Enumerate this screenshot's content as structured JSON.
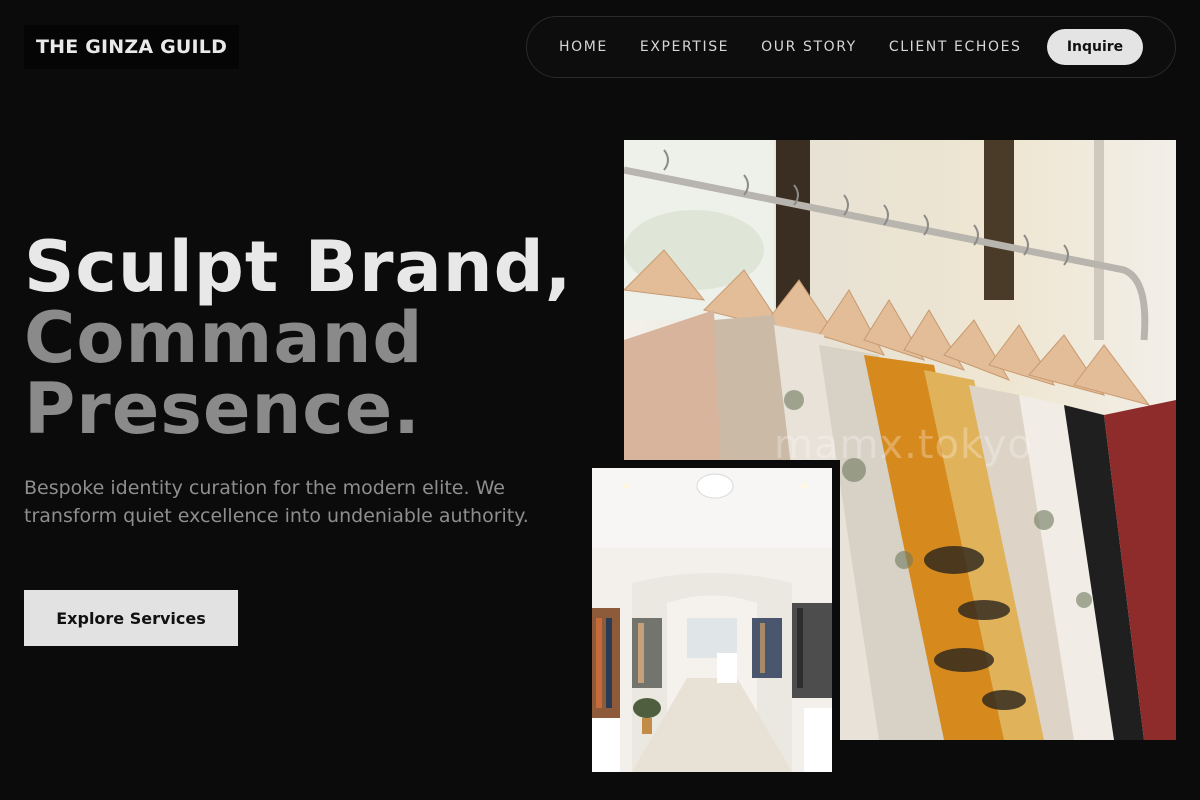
{
  "brand": {
    "logo_text": "THE GINZA GUILD"
  },
  "nav": {
    "links": [
      "HOME",
      "EXPERTISE",
      "OUR STORY",
      "CLIENT ECHOES"
    ],
    "cta_label": "Inquire"
  },
  "hero": {
    "headline_line1": "Sculpt Brand,",
    "headline_line2": "Command",
    "headline_line3": "Presence.",
    "subtext": "Bespoke identity curation for the modern elite. We transform quiet excellence into undeniable authority.",
    "cta_label": "Explore Services"
  },
  "images": {
    "rack_photo": "clothing-rack-photo",
    "store_photo": "boutique-interior-photo",
    "watermark": "mamx.tokyo"
  },
  "colors": {
    "background": "#0b0b0b",
    "headline_primary": "#e8e8e8",
    "headline_secondary": "#8a8a8a",
    "button_bg": "#e2e2e2"
  }
}
